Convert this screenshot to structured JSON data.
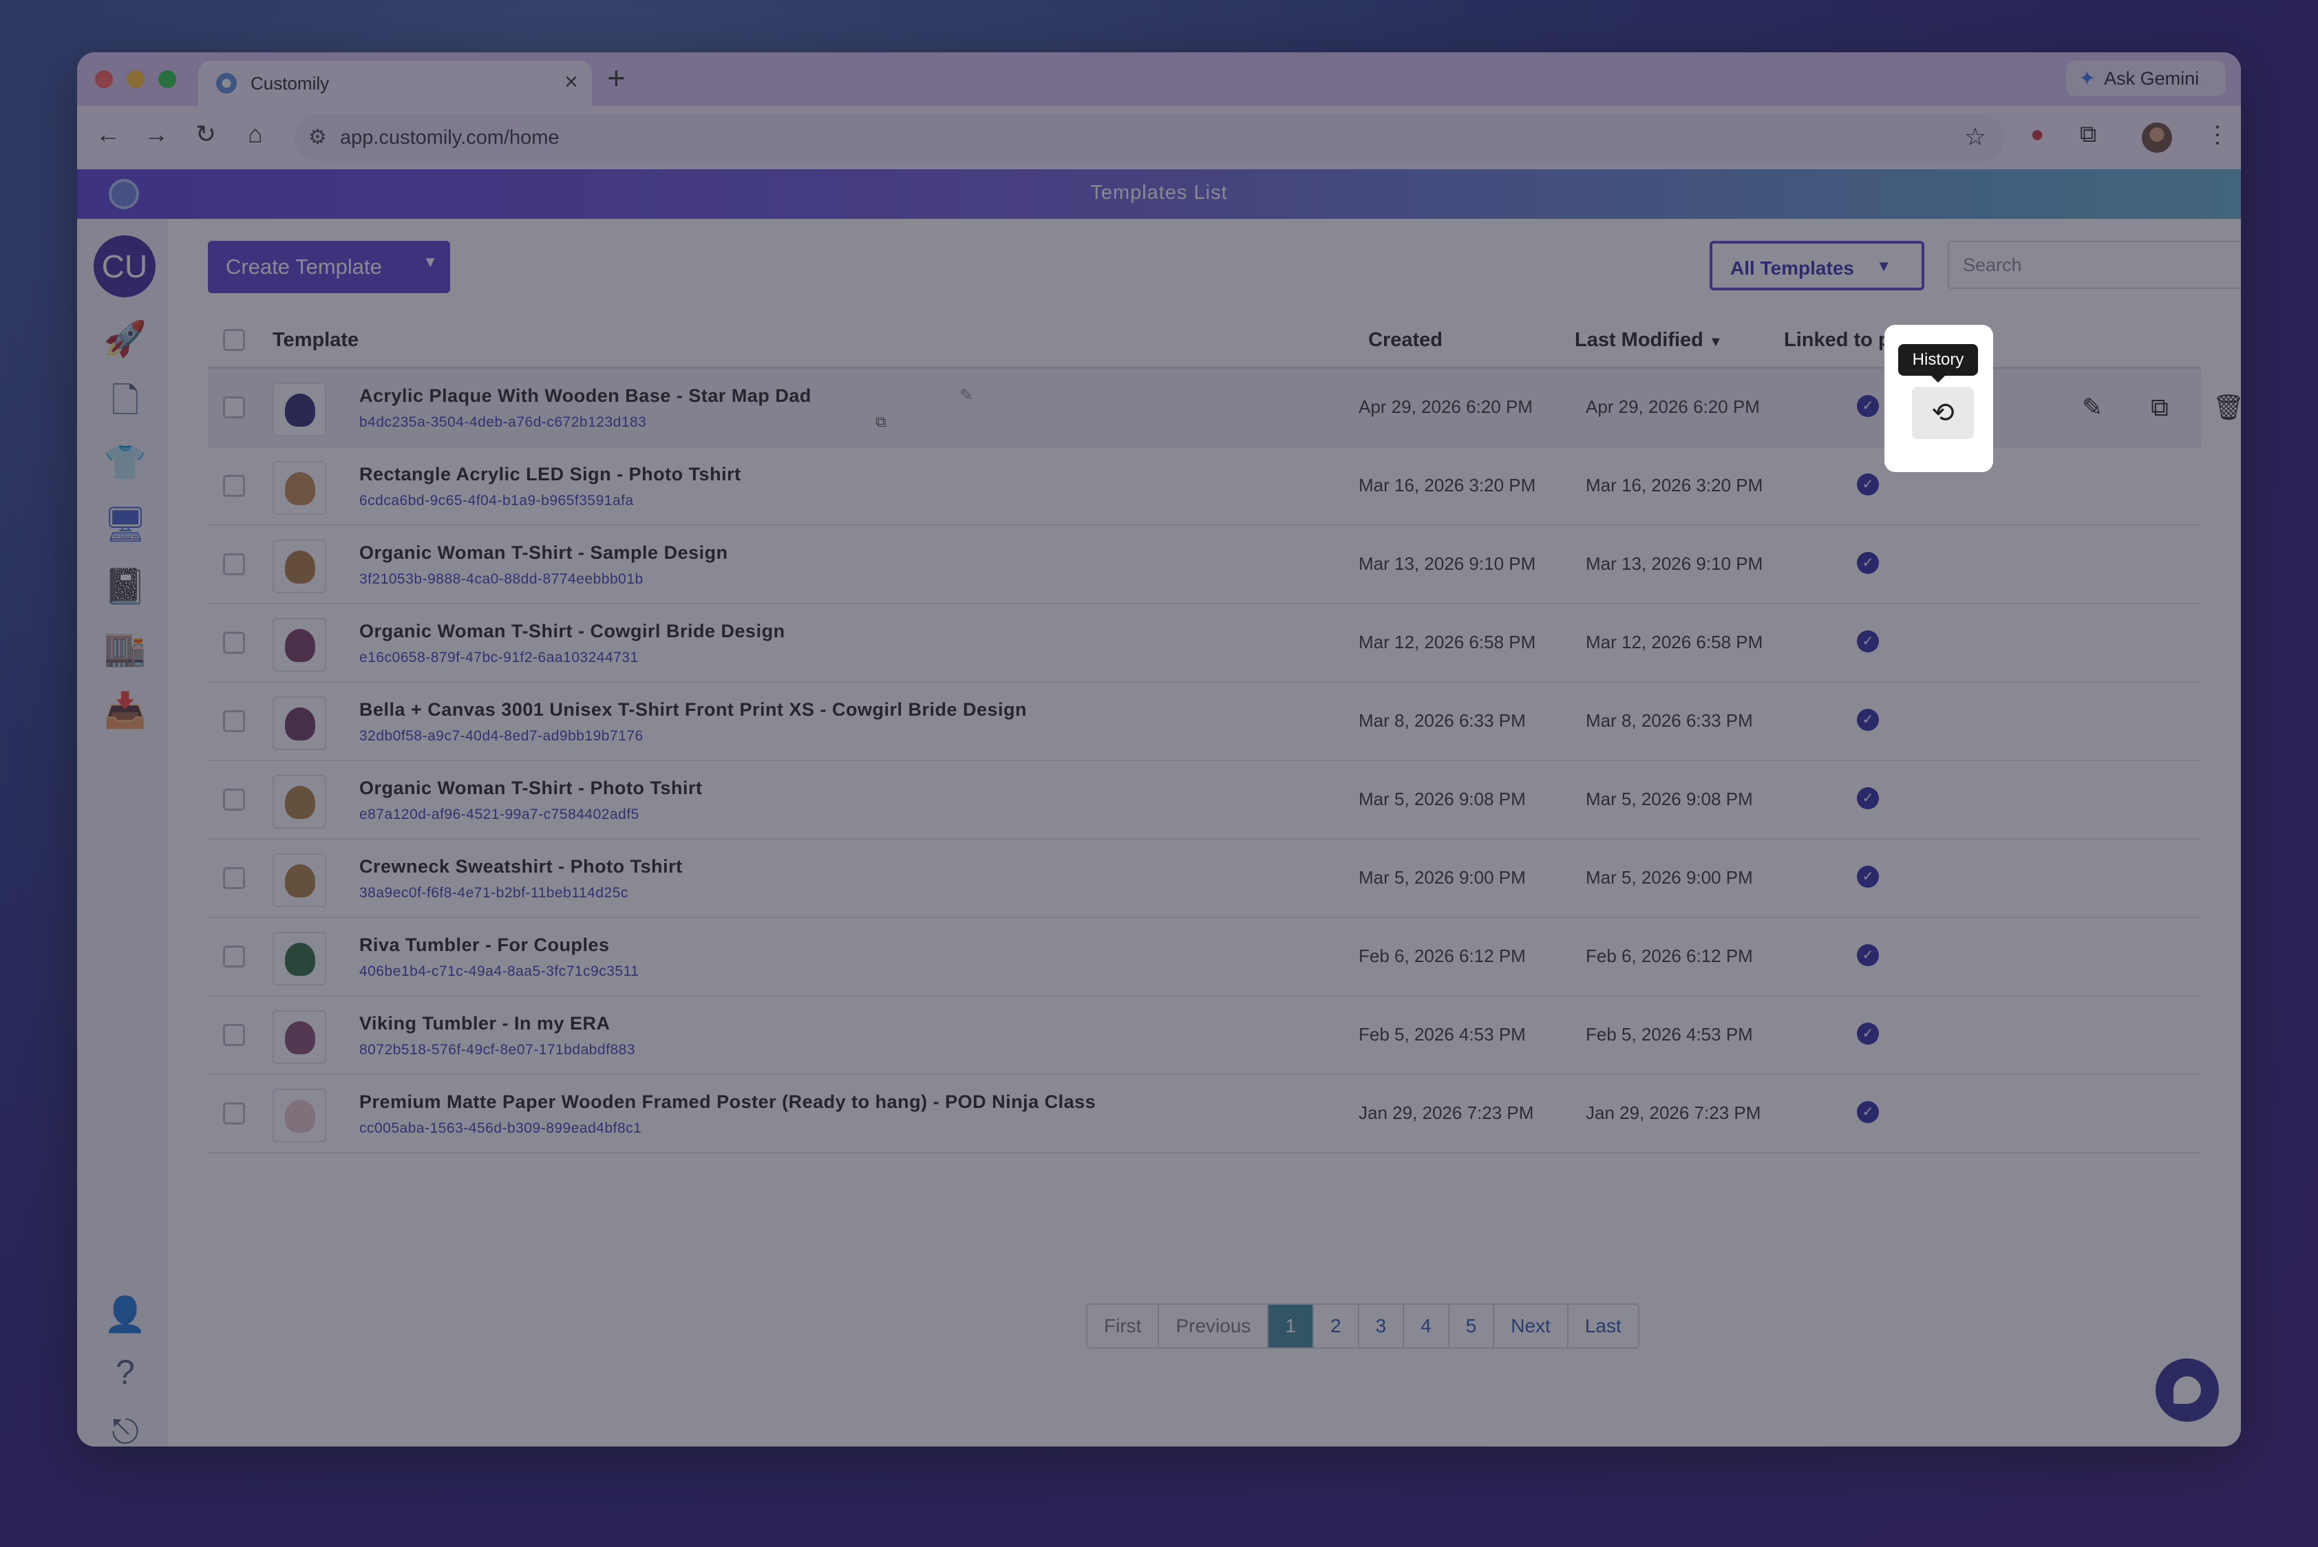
{
  "browser": {
    "tab_title": "Customily",
    "url": "app.customily.com/home",
    "ask_gemini": "Ask Gemini"
  },
  "app": {
    "header_title": "Templates List",
    "user_initials": "CU",
    "create_label": "Create Template",
    "filter_label": "All Templates",
    "search_placeholder": "Search"
  },
  "table": {
    "headers": {
      "template": "Template",
      "created": "Created",
      "modified": "Last Modified",
      "linked": "Linked to product"
    },
    "rows": [
      {
        "name": "Acrylic Plaque With Wooden Base - Star Map Dad",
        "id": "b4dc235a-3504-4deb-a76d-c672b123d183",
        "created": "Apr 29, 2026 6:20 PM",
        "modified": "Apr 29, 2026 6:20 PM"
      },
      {
        "name": "Rectangle Acrylic LED Sign - Photo Tshirt",
        "id": "6cdca6bd-9c65-4f04-b1a9-b965f3591afa",
        "created": "Mar 16, 2026 3:20 PM",
        "modified": "Mar 16, 2026 3:20 PM"
      },
      {
        "name": "Organic Woman T-Shirt - Sample Design",
        "id": "3f21053b-9888-4ca0-88dd-8774eebbb01b",
        "created": "Mar 13, 2026 9:10 PM",
        "modified": "Mar 13, 2026 9:10 PM"
      },
      {
        "name": "Organic Woman T-Shirt - Cowgirl Bride Design",
        "id": "e16c0658-879f-47bc-91f2-6aa103244731",
        "created": "Mar 12, 2026 6:58 PM",
        "modified": "Mar 12, 2026 6:58 PM"
      },
      {
        "name": "Bella + Canvas 3001 Unisex T-Shirt Front Print XS - Cowgirl Bride Design",
        "id": "32db0f58-a9c7-40d4-8ed7-ad9bb19b7176",
        "created": "Mar 8, 2026 6:33 PM",
        "modified": "Mar 8, 2026 6:33 PM"
      },
      {
        "name": "Organic Woman T-Shirt - Photo Tshirt",
        "id": "e87a120d-af96-4521-99a7-c7584402adf5",
        "created": "Mar 5, 2026 9:08 PM",
        "modified": "Mar 5, 2026 9:08 PM"
      },
      {
        "name": "Crewneck Sweatshirt - Photo Tshirt",
        "id": "38a9ec0f-f6f8-4e71-b2bf-11beb114d25c",
        "created": "Mar 5, 2026 9:00 PM",
        "modified": "Mar 5, 2026 9:00 PM"
      },
      {
        "name": "Riva Tumbler - For Couples",
        "id": "406be1b4-c71c-49a4-8aa5-3fc71c9c3511",
        "created": "Feb 6, 2026 6:12 PM",
        "modified": "Feb 6, 2026 6:12 PM"
      },
      {
        "name": "Viking Tumbler - In my ERA",
        "id": "8072b518-576f-49cf-8e07-171bdabdf883",
        "created": "Feb 5, 2026 4:53 PM",
        "modified": "Feb 5, 2026 4:53 PM"
      },
      {
        "name": "Premium Matte Paper Wooden Framed Poster (Ready to hang) - POD Ninja Class",
        "id": "cc005aba-1563-456d-b309-899ead4bf8c1",
        "created": "Jan 29, 2026 7:23 PM",
        "modified": "Jan 29, 2026 7:23 PM"
      }
    ]
  },
  "tooltip": "History",
  "pagination": [
    "First",
    "Previous",
    "1",
    "2",
    "3",
    "4",
    "5",
    "Next",
    "Last"
  ],
  "colors": {
    "accent": "#5541c9",
    "link": "#3f3ab0",
    "active_page": "#3e8c97"
  }
}
